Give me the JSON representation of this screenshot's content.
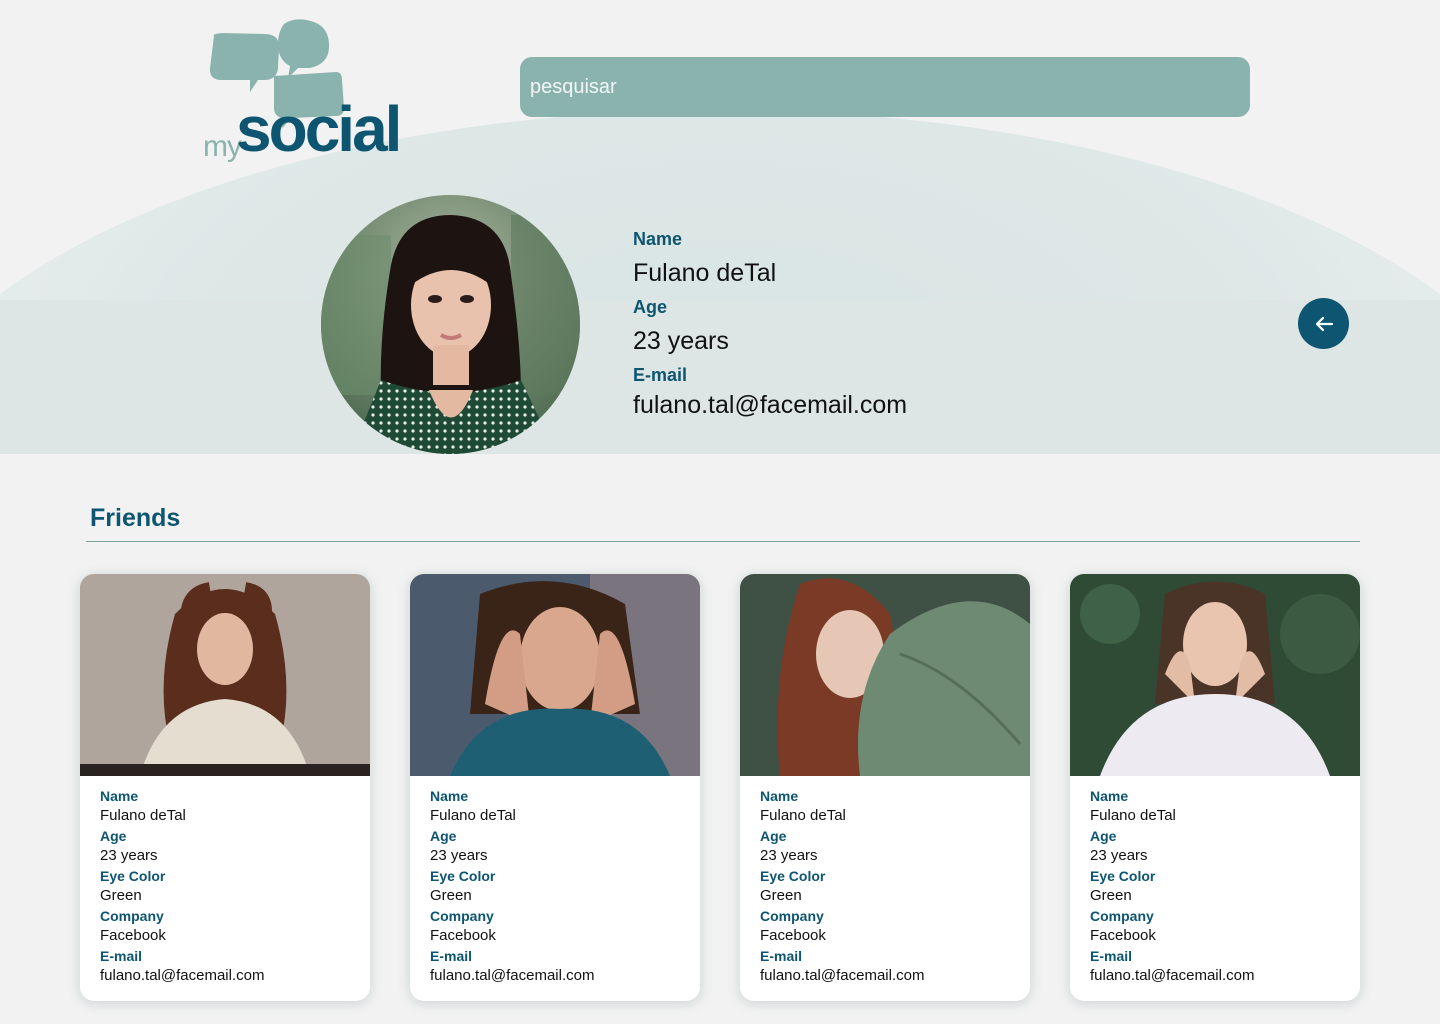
{
  "header": {
    "logo_my": "my",
    "logo_social": "social",
    "search_placeholder": "pesquisar"
  },
  "profile": {
    "name_label": "Name",
    "name": "Fulano deTal",
    "age_label": "Age",
    "age": "23 years",
    "email_label": "E-mail",
    "email": "fulano.tal@facemail.com",
    "back_icon": "arrow-left-icon"
  },
  "friends": {
    "title": "Friends",
    "labels": {
      "name": "Name",
      "age": "Age",
      "eye_color": "Eye Color",
      "company": "Company",
      "email": "E-mail"
    },
    "items": [
      {
        "name": "Fulano deTal",
        "age": "23 years",
        "eye_color": "Green",
        "company": "Facebook",
        "email": "fulano.tal@facemail.com"
      },
      {
        "name": "Fulano deTal",
        "age": "23 years",
        "eye_color": "Green",
        "company": "Facebook",
        "email": "fulano.tal@facemail.com"
      },
      {
        "name": "Fulano deTal",
        "age": "23 years",
        "eye_color": "Green",
        "company": "Facebook",
        "email": "fulano.tal@facemail.com"
      },
      {
        "name": "Fulano deTal",
        "age": "23 years",
        "eye_color": "Green",
        "company": "Facebook",
        "email": "fulano.tal@facemail.com"
      }
    ]
  },
  "colors": {
    "accent": "#0d5570",
    "search_bg": "#8ab3ad",
    "page_bg": "#f2f2f2"
  }
}
